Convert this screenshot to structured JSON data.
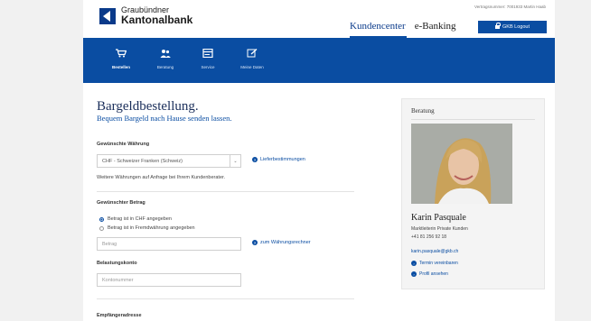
{
  "header": {
    "logo_line1": "Graubündner",
    "logo_line2": "Kantonalbank",
    "contract": "Vertragsnummer: 7001933 Martin Haab",
    "nav": [
      "Kundencenter",
      "e-Banking"
    ],
    "logout": "GKB Logout"
  },
  "band": {
    "items": [
      {
        "label": "Bestellen",
        "icon": "cart-icon"
      },
      {
        "label": "Beratung",
        "icon": "people-icon"
      },
      {
        "label": "Service",
        "icon": "card-icon"
      },
      {
        "label": "Meine Daten",
        "icon": "edit-icon"
      }
    ]
  },
  "main": {
    "title": "Bargeldbestellung.",
    "subtitle": "Bequem Bargeld nach Hause senden lassen.",
    "currency": {
      "label": "Gewünschte Währung",
      "value": "CHF - Schweizer Franken (Schweiz)",
      "help": "Lieferbestimmungen",
      "note": "Weitere Währungen auf Anfrage bei Ihrem Kundenberater."
    },
    "amount": {
      "label": "Gewünschter Betrag",
      "options": [
        "Betrag ist in CHF angegeben",
        "Betrag ist in Fremdwährung angegeben"
      ],
      "placeholder": "Betrag",
      "help": "zum Währungsrechner"
    },
    "account": {
      "label": "Belastungskonto",
      "placeholder": "Kontonummer"
    },
    "recipient_label": "Empfängeradresse"
  },
  "advisor": {
    "heading": "Beratung",
    "name": "Karin Pasquale",
    "role": "Marktleiterin Private Kunden",
    "phone": "+41 81 256 92 18",
    "email": "karin.pasquale@gkb.ch",
    "links": [
      "Termin vereinbaren",
      "Profil ansehen"
    ]
  },
  "colors": {
    "brand": "#0a4da2",
    "title": "#1a2e5a"
  }
}
